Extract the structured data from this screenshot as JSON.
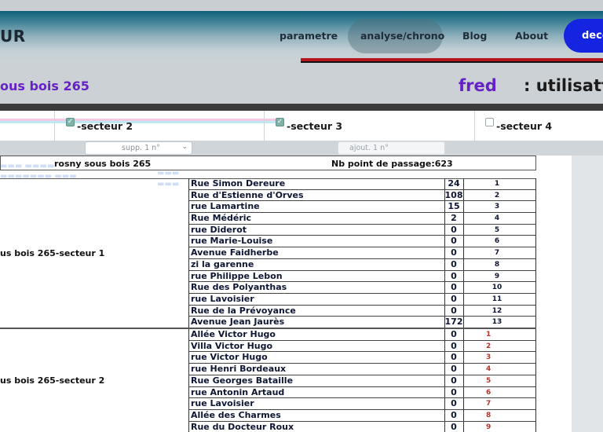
{
  "header": {
    "logo": "UR",
    "nav": [
      "parametre",
      "analyse/chrono",
      "Blog",
      "About"
    ],
    "active_nav": "analyse/chrono",
    "deco_button": "deco"
  },
  "site": {
    "name": "ous bois 265",
    "user": "fred",
    "user_label": ": utilisatt"
  },
  "tabs": [
    {
      "label": "-secteur 2",
      "checked": true
    },
    {
      "label": "-secteur 3",
      "checked": true
    },
    {
      "label": "-secteur 4",
      "checked": false
    }
  ],
  "controls": {
    "remove_select": "supp. 1 n°",
    "add_placeholder": "ajout. 1 n°"
  },
  "summary": {
    "site": "rosny sous bois 265",
    "points": "Nb point de passage:623"
  },
  "sectors": [
    {
      "name": "us bois 265-secteur 1",
      "style": "plain",
      "rows": [
        {
          "street": "Rue Simon Dereure",
          "count": "24",
          "index": "1"
        },
        {
          "street": "Rue d'Estienne d'Orves",
          "count": "108",
          "index": "2"
        },
        {
          "street": "rue Lamartine",
          "count": "15",
          "index": "3"
        },
        {
          "street": "Rue Médéric",
          "count": "2",
          "index": "4"
        },
        {
          "street": "rue Diderot",
          "count": "0",
          "index": "5"
        },
        {
          "street": "rue Marie-Louise",
          "count": "0",
          "index": "6"
        },
        {
          "street": "Avenue Faidherbe",
          "count": "0",
          "index": "7"
        },
        {
          "street": "zi la garenne",
          "count": "0",
          "index": "8"
        },
        {
          "street": "rue Philippe Lebon",
          "count": "0",
          "index": "9"
        },
        {
          "street": "Rue des Polyanthas",
          "count": "0",
          "index": "10"
        },
        {
          "street": "rue Lavoisier",
          "count": "0",
          "index": "11"
        },
        {
          "street": "Rue de la Prévoyance",
          "count": "0",
          "index": "12"
        },
        {
          "street": "Avenue Jean Jaurès",
          "count": "172",
          "index": "13"
        }
      ]
    },
    {
      "name": "us bois 265-secteur 2",
      "style": "red",
      "rows": [
        {
          "street": "Allée Victor Hugo",
          "count": "0",
          "index": "1"
        },
        {
          "street": "Villa Victor Hugo",
          "count": "0",
          "index": "2"
        },
        {
          "street": "rue Victor Hugo",
          "count": "0",
          "index": "3"
        },
        {
          "street": "rue Henri Bordeaux",
          "count": "0",
          "index": "4"
        },
        {
          "street": "Rue Georges Bataille",
          "count": "0",
          "index": "5"
        },
        {
          "street": "rue Antonin Artaud",
          "count": "0",
          "index": "6"
        },
        {
          "street": "rue Lavoisier",
          "count": "0",
          "index": "7"
        },
        {
          "street": "Allée des Charmes",
          "count": "0",
          "index": "8"
        },
        {
          "street": "Rue du Docteur Roux",
          "count": "0",
          "index": "9"
        }
      ]
    }
  ],
  "colors": {
    "accent_purple": "#6622c8",
    "deco_blue": "#1524e0",
    "red_line": "#b8161f",
    "index_red": "#b5372c"
  }
}
